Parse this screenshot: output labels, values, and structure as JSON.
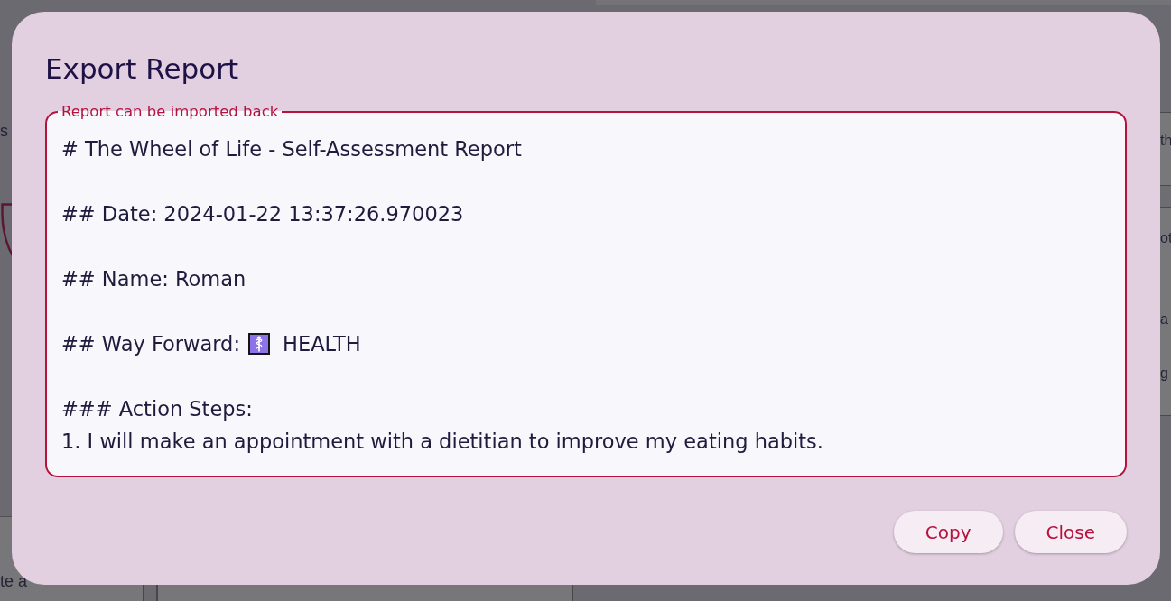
{
  "behind_dialog": {
    "left_top": "s",
    "left_bottom": "te a",
    "right_box": "th",
    "right_list": [
      "ot",
      "a",
      "g"
    ]
  },
  "dialog": {
    "title": "Export Report",
    "report_field": {
      "label": "Report can be imported back",
      "blocks": [
        [
          {
            "kind": "text",
            "text": "# The Wheel of Life - Self-Assessment Report"
          }
        ],
        [
          {
            "kind": "text",
            "text": "## Date: 2024-01-22 13:37:26.970023"
          }
        ],
        [
          {
            "kind": "text",
            "text": "## Name: Roman"
          }
        ],
        [
          {
            "kind": "icon_value",
            "label": "## Way Forward:",
            "value": "HEALTH"
          }
        ],
        [
          {
            "kind": "text",
            "text": "### Action Steps:"
          },
          {
            "kind": "text",
            "text": "1. I will make an appointment with a dietitian to improve my eating habits."
          }
        ]
      ]
    },
    "buttons": [
      "Copy",
      "Close"
    ]
  }
}
